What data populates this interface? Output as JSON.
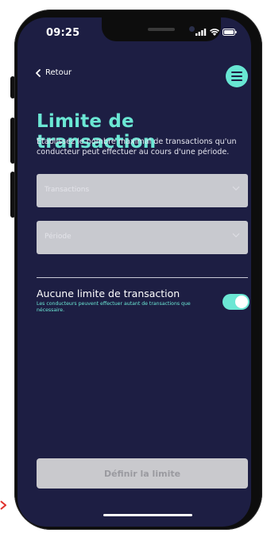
{
  "status_bar": {
    "time": "09:25"
  },
  "nav": {
    "back_label": "Retour"
  },
  "header": {
    "title": "Limite de transaction",
    "subtitle": "Établissez le nombre maximal de transactions qu'un conducteur peut effectuer au cours d'une période."
  },
  "form": {
    "transactions_placeholder": "Transactions",
    "period_placeholder": "Période"
  },
  "no_limit": {
    "title": "Aucune limite de transaction",
    "description": "Les conducteurs peuvent effectuer autant de transactions que nécessaire.",
    "enabled": true
  },
  "actions": {
    "submit_label": "Définir la limite"
  },
  "colors": {
    "background": "#1d1e43",
    "accent": "#6be7d4",
    "input_bg": "#c8c9cf",
    "button_disabled": "#c9c9cd"
  }
}
